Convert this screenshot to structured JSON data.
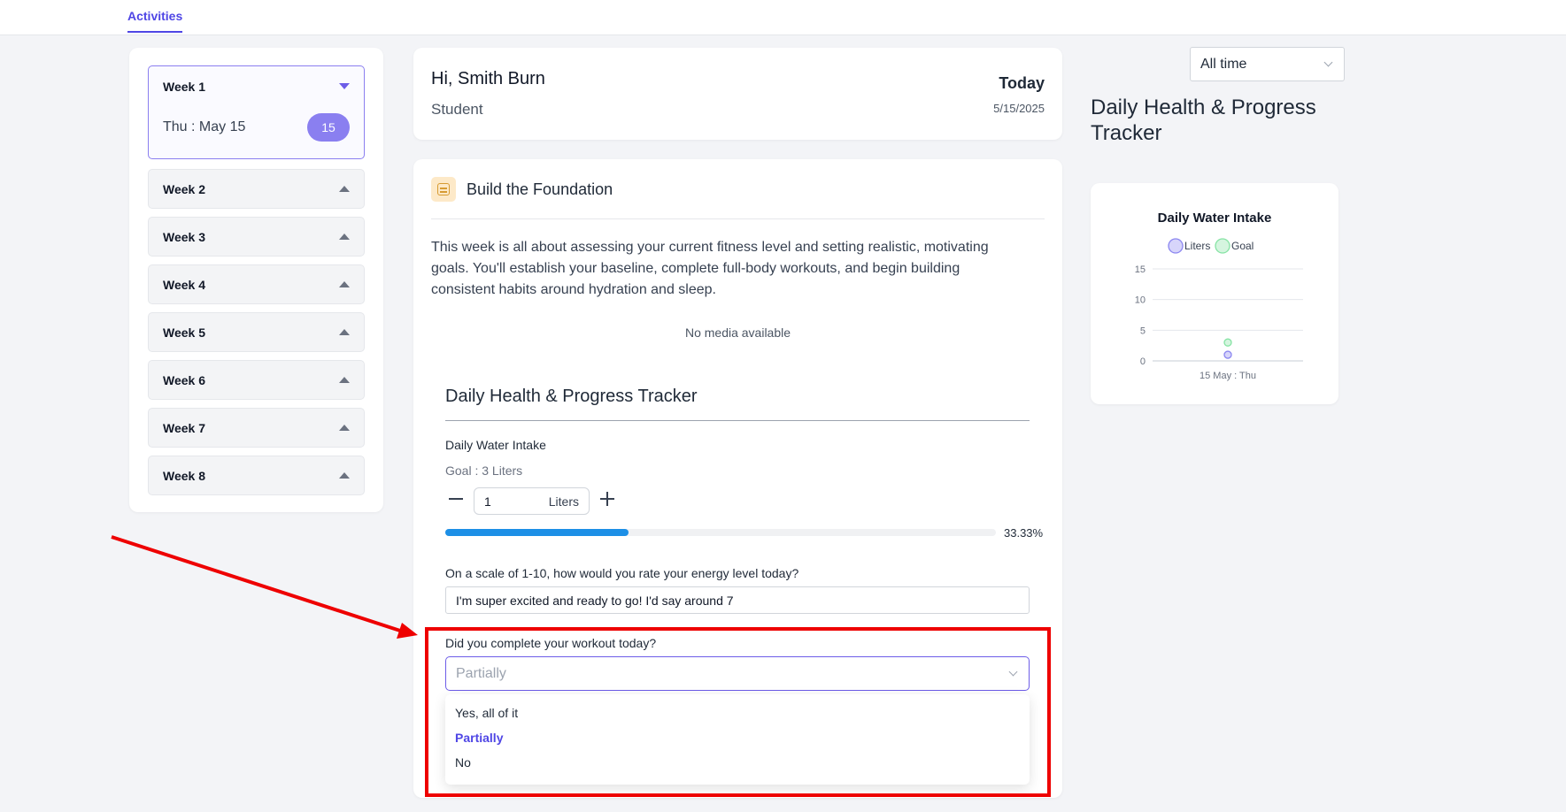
{
  "nav": {
    "active_tab": "Activities"
  },
  "sidebar": {
    "weeks": [
      {
        "label": "Week 1",
        "expanded": true,
        "day_label": "Thu : May 15",
        "day_badge": "15"
      },
      {
        "label": "Week 2"
      },
      {
        "label": "Week 3"
      },
      {
        "label": "Week 4"
      },
      {
        "label": "Week 5"
      },
      {
        "label": "Week 6"
      },
      {
        "label": "Week 7"
      },
      {
        "label": "Week 8"
      }
    ]
  },
  "greeting": {
    "name": "Hi, Smith Burn",
    "role": "Student",
    "today_label": "Today",
    "date": "5/15/2025"
  },
  "lesson": {
    "title": "Build the Foundation",
    "description": "This week is all about assessing your current fitness level and setting realistic, motivating goals. You'll establish your baseline, complete full-body workouts, and begin building consistent habits around hydration and sleep.",
    "no_media": "No media available"
  },
  "tracker": {
    "title": "Daily Health & Progress Tracker",
    "water": {
      "label": "Daily Water Intake",
      "goal": "Goal : 3 Liters",
      "value": "1",
      "unit": "Liters",
      "progress": 0.3333,
      "progress_text": "33.33%"
    },
    "energy": {
      "question": "On a scale of 1-10, how would you rate your energy level today?",
      "answer": "I'm super excited and ready to go! I'd say around 7"
    },
    "workout": {
      "question": "Did you complete your workout today?",
      "selected": "Partially",
      "options": [
        "Yes, all of it",
        "Partially",
        "No"
      ]
    }
  },
  "right_panel": {
    "filter": "All time",
    "title": "Daily Health & Progress Tracker"
  },
  "chart_data": {
    "type": "scatter",
    "title": "Daily Water Intake",
    "categories": [
      "15 May : Thu"
    ],
    "series": [
      {
        "name": "Liters",
        "values": [
          1
        ],
        "color": "#8b86f0"
      },
      {
        "name": "Goal",
        "values": [
          3
        ],
        "color": "#86e3a4"
      }
    ],
    "ylim": [
      0,
      15
    ],
    "yticks": [
      0,
      5,
      10,
      15
    ],
    "grid": true,
    "legend": "top"
  },
  "colors": {
    "accent": "#4f46e5",
    "badge": "#8a7ff0",
    "progress": "#1d8fe6",
    "highlight": "#ee0000"
  }
}
